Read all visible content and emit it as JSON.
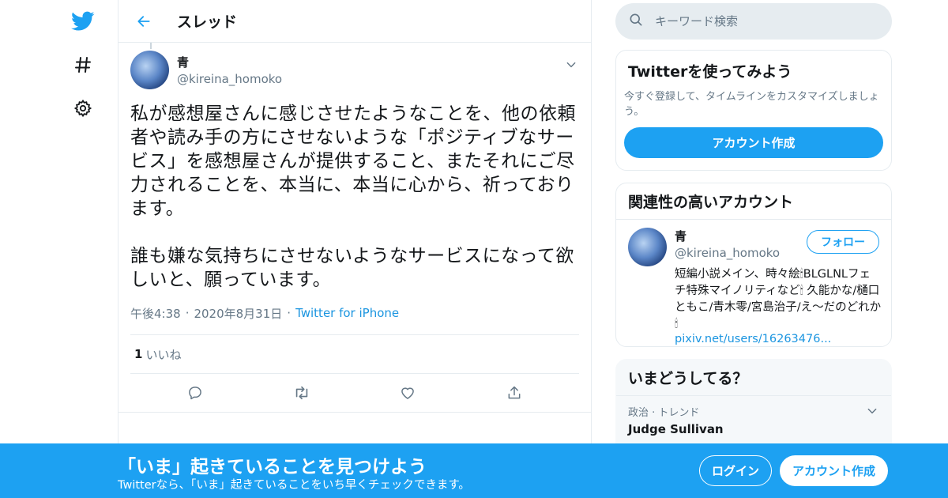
{
  "colors": {
    "accent": "#1da1f2",
    "link": "#1b95e0",
    "secondary_text": "#657786",
    "border": "#e6ecf0"
  },
  "nav": {
    "items": [
      {
        "icon": "twitter-logo-icon"
      },
      {
        "icon": "hashtag-icon"
      },
      {
        "icon": "gear-icon"
      }
    ]
  },
  "topbar": {
    "title": "スレッド",
    "back_icon": "arrow-left-icon"
  },
  "tweet": {
    "name": "青",
    "handle": "@kireina_homoko",
    "text": "私が感想屋さんに感じさせたようなことを、他の依頼者や読み手の方にさせないような「ポジティブなサービス」を感想屋さんが提供すること、またそれにご尽力されることを、本当に、本当に心から、祈っております。\n\n誰も嫌な気持ちにさせないようなサービスになって欲しいと、願っています。",
    "time": "午後4:38",
    "date": "2020年8月31日",
    "source": "Twitter for iPhone",
    "likes_count": "1",
    "likes_label": "いいね",
    "actions": [
      "reply-icon",
      "retweet-icon",
      "like-icon",
      "share-icon"
    ]
  },
  "search": {
    "placeholder": "キーワード検索"
  },
  "signup_card": {
    "title": "Twitterを使ってみよう",
    "desc": "今すぐ登録して、タイムラインをカスタマイズしましょう。",
    "button": "アカウント作成"
  },
  "related": {
    "title": "関連性の高いアカウント",
    "name": "青",
    "handle": "@kireina_homoko",
    "follow": "フォロー",
    "bio": "短編小説メイン、時々絵🕯BLGLNLフェチ特殊マイノリティなど🕯 久能かな/樋口ともこ/青木零/宮島治子/え〜だのどれか🕯",
    "link": "pixiv.net/users/16263476..."
  },
  "trends": {
    "title": "いまどうしてる？",
    "items": [
      {
        "category": "政治 · トレンド",
        "name": "Judge Sullivan"
      }
    ]
  },
  "banner": {
    "title": "「いま」起きていることを見つけよう",
    "sub": "Twitterなら、「いま」起きていることをいち早くチェックできます。",
    "login": "ログイン",
    "signup": "アカウント作成"
  }
}
